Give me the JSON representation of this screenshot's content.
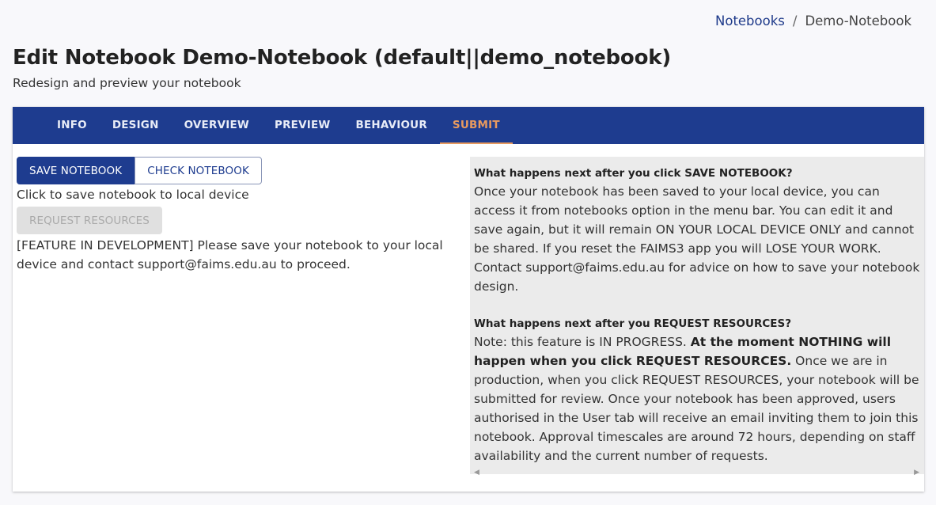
{
  "breadcrumb": {
    "link": "Notebooks",
    "separator": "/",
    "current": "Demo-Notebook"
  },
  "page": {
    "title": "Edit Notebook Demo-Notebook (default||demo_notebook)",
    "subtitle": "Redesign and preview your notebook"
  },
  "tabs": [
    {
      "label": "INFO"
    },
    {
      "label": "DESIGN"
    },
    {
      "label": "OVERVIEW"
    },
    {
      "label": "PREVIEW"
    },
    {
      "label": "BEHAVIOUR"
    },
    {
      "label": "SUBMIT"
    }
  ],
  "active_tab": "SUBMIT",
  "actions": {
    "save_label": "SAVE NOTEBOOK",
    "check_label": "CHECK NOTEBOOK",
    "save_hint": "Click to save notebook to local device",
    "request_label": "REQUEST RESOURCES",
    "dev_note": "[FEATURE IN DEVELOPMENT] Please save your notebook to your local device and contact support@faims.edu.au to proceed."
  },
  "info": {
    "save_heading": "What happens next after you click SAVE NOTEBOOK?",
    "save_text": "Once your notebook has been saved to your local device, you can access it from notebooks option in the menu bar. You can edit it and save again, but it will remain ON YOUR LOCAL DEVICE ONLY and cannot be shared. If you reset the FAIMS3 app you will LOSE YOUR WORK. Contact support@faims.edu.au for advice on how to save your notebook design.",
    "request_heading": "What happens next after you REQUEST RESOURCES?",
    "request_note": "Note: this feature is IN PROGRESS.",
    "request_strong": "At the moment NOTHING will happen when you click REQUEST RESOURCES.",
    "request_text": "Once we are in production, when you click REQUEST RESOURCES, your notebook will be submitted for review. Once your notebook has been approved, users authorised in the User tab will receive an email inviting them to join this notebook. Approval timescales are around 72 hours, depending on staff availability and the current number of requests."
  },
  "scroll": {
    "left_icon": "◀",
    "right_icon": "▶"
  },
  "colors": {
    "primary": "#1e3c8f",
    "active_tab": "#e89a5f",
    "panel_bg": "#ebebeb"
  }
}
